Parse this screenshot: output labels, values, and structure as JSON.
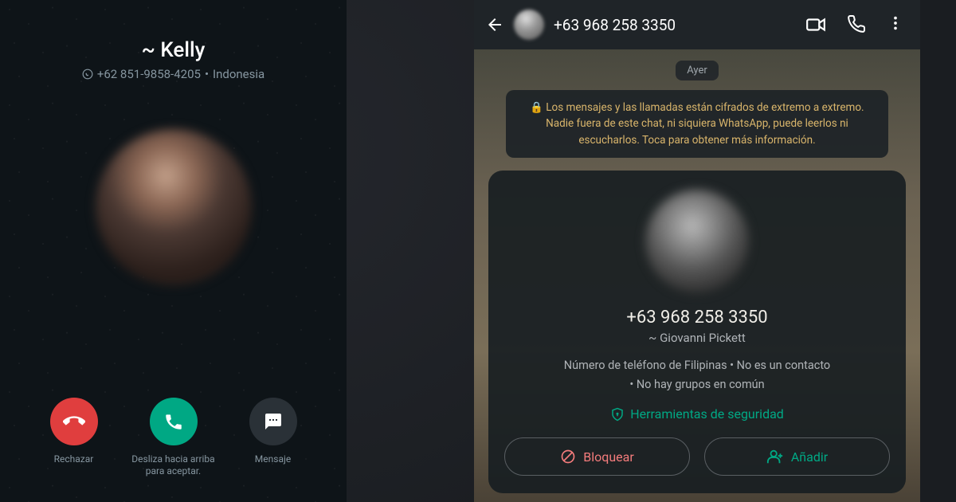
{
  "call_screen": {
    "caller_name": "~ Kelly",
    "phone": "+62 851-9858-4205",
    "country": "Indonesia",
    "decline_label": "Rechazar",
    "accept_label": "Desliza hacia arriba para aceptar.",
    "message_label": "Mensaje"
  },
  "chat_screen": {
    "top_phone": "+63 968 258 3350",
    "date_label": "Ayer",
    "encryption_notice": "Los mensajes y las llamadas están cifrados de extremo a extremo. Nadie fuera de este chat, ni siquiera WhatsApp, puede leerlos ni escucharlos. Toca para obtener más información.",
    "card_phone": "+63 968 258 3350",
    "card_name": "~ Giovanni Pickett",
    "info_line1": "Número de teléfono de Filipinas • No es un contacto",
    "info_line2": "• No hay grupos en común",
    "security_tools": "Herramientas de seguridad",
    "block_label": "Bloquear",
    "add_label": "Añadir"
  },
  "colors": {
    "accept_green": "#00a884",
    "decline_red": "#e03e3e",
    "notice_gold": "#d9b56b",
    "block_red": "#f47c7c"
  }
}
